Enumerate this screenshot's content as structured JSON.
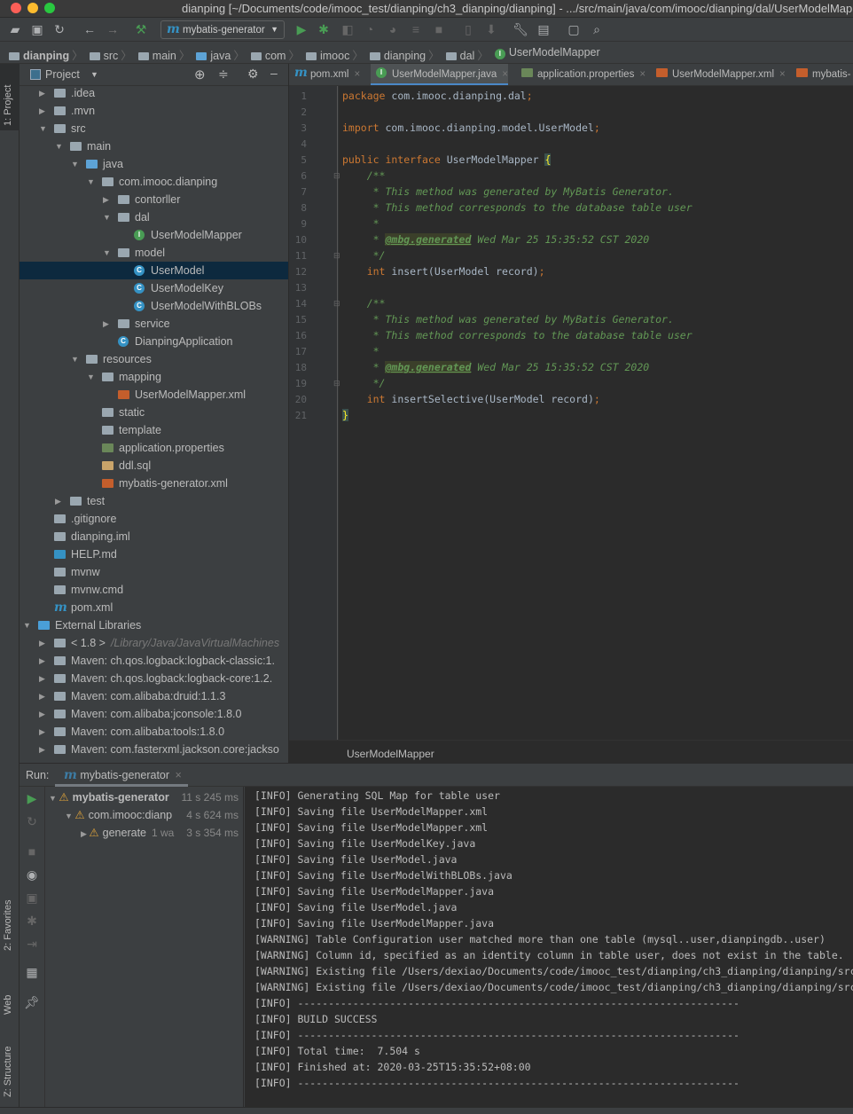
{
  "window": {
    "title": "dianping [~/Documents/code/imooc_test/dianping/ch3_dianping/dianping] - .../src/main/java/com/imooc/dianping/dal/UserModelMapper.java"
  },
  "toolbar": {
    "run_config": "mybatis-generator"
  },
  "breadcrumbs": [
    "dianping",
    "src",
    "main",
    "java",
    "com",
    "imooc",
    "dianping",
    "dal",
    "UserModelMapper"
  ],
  "left_strip": {
    "project": "1: Project",
    "favorites": "2: Favorites",
    "web": "Web",
    "structure": "Z: Structure"
  },
  "project": {
    "title": "Project",
    "tree": [
      {
        "label": ".idea",
        "depth": 1,
        "arrow": "closed",
        "icon": "folder"
      },
      {
        "label": ".mvn",
        "depth": 1,
        "arrow": "closed",
        "icon": "folder"
      },
      {
        "label": "src",
        "depth": 1,
        "arrow": "open",
        "icon": "folder"
      },
      {
        "label": "main",
        "depth": 2,
        "arrow": "open",
        "icon": "folder"
      },
      {
        "label": "java",
        "depth": 3,
        "arrow": "open",
        "icon": "folder-blue"
      },
      {
        "label": "com.imooc.dianping",
        "depth": 4,
        "arrow": "open",
        "icon": "package"
      },
      {
        "label": "contorller",
        "depth": 5,
        "arrow": "closed",
        "icon": "package"
      },
      {
        "label": "dal",
        "depth": 5,
        "arrow": "open",
        "icon": "package"
      },
      {
        "label": "UserModelMapper",
        "depth": 6,
        "arrow": "none",
        "icon": "interface"
      },
      {
        "label": "model",
        "depth": 5,
        "arrow": "open",
        "icon": "package"
      },
      {
        "label": "UserModel",
        "depth": 6,
        "arrow": "none",
        "icon": "class",
        "selected": true
      },
      {
        "label": "UserModelKey",
        "depth": 6,
        "arrow": "none",
        "icon": "class"
      },
      {
        "label": "UserModelWithBLOBs",
        "depth": 6,
        "arrow": "none",
        "icon": "class"
      },
      {
        "label": "service",
        "depth": 5,
        "arrow": "closed",
        "icon": "package"
      },
      {
        "label": "DianpingApplication",
        "depth": 5,
        "arrow": "none",
        "icon": "spring-class"
      },
      {
        "label": "resources",
        "depth": 3,
        "arrow": "open",
        "icon": "folder-res"
      },
      {
        "label": "mapping",
        "depth": 4,
        "arrow": "open",
        "icon": "folder"
      },
      {
        "label": "UserModelMapper.xml",
        "depth": 5,
        "arrow": "none",
        "icon": "xml"
      },
      {
        "label": "static",
        "depth": 4,
        "arrow": "none",
        "icon": "folder"
      },
      {
        "label": "template",
        "depth": 4,
        "arrow": "none",
        "icon": "folder"
      },
      {
        "label": "application.properties",
        "depth": 4,
        "arrow": "none",
        "icon": "properties"
      },
      {
        "label": "ddl.sql",
        "depth": 4,
        "arrow": "none",
        "icon": "sql"
      },
      {
        "label": "mybatis-generator.xml",
        "depth": 4,
        "arrow": "none",
        "icon": "xml"
      },
      {
        "label": "test",
        "depth": 2,
        "arrow": "closed",
        "icon": "folder"
      },
      {
        "label": ".gitignore",
        "depth": 1,
        "arrow": "none",
        "icon": "file"
      },
      {
        "label": "dianping.iml",
        "depth": 1,
        "arrow": "none",
        "icon": "file"
      },
      {
        "label": "HELP.md",
        "depth": 1,
        "arrow": "none",
        "icon": "md"
      },
      {
        "label": "mvnw",
        "depth": 1,
        "arrow": "none",
        "icon": "file"
      },
      {
        "label": "mvnw.cmd",
        "depth": 1,
        "arrow": "none",
        "icon": "file"
      },
      {
        "label": "pom.xml",
        "depth": 1,
        "arrow": "none",
        "icon": "maven"
      },
      {
        "label": "External Libraries",
        "depth": 0,
        "arrow": "open",
        "icon": "libraries"
      },
      {
        "label": "< 1.8 >",
        "suffix": "/Library/Java/JavaVirtualMachines",
        "depth": 1,
        "arrow": "closed",
        "icon": "jdk"
      },
      {
        "label": "Maven: ch.qos.logback:logback-classic:1.",
        "depth": 1,
        "arrow": "closed",
        "icon": "library"
      },
      {
        "label": "Maven: ch.qos.logback:logback-core:1.2.",
        "depth": 1,
        "arrow": "closed",
        "icon": "library"
      },
      {
        "label": "Maven: com.alibaba:druid:1.1.3",
        "depth": 1,
        "arrow": "closed",
        "icon": "library"
      },
      {
        "label": "Maven: com.alibaba:jconsole:1.8.0",
        "depth": 1,
        "arrow": "closed",
        "icon": "library"
      },
      {
        "label": "Maven: com.alibaba:tools:1.8.0",
        "depth": 1,
        "arrow": "closed",
        "icon": "library"
      },
      {
        "label": "Maven: com.fasterxml.jackson.core:jackso",
        "depth": 1,
        "arrow": "closed",
        "icon": "library"
      }
    ]
  },
  "editor": {
    "tabs": [
      {
        "label": "pom.xml",
        "icon": "maven"
      },
      {
        "label": "UserModelMapper.java",
        "icon": "interface",
        "active": true
      },
      {
        "label": "application.properties",
        "icon": "properties"
      },
      {
        "label": "UserModelMapper.xml",
        "icon": "xml"
      },
      {
        "label": "mybatis-",
        "icon": "xml"
      }
    ],
    "lines": [
      [
        [
          "kw",
          "package "
        ],
        [
          "",
          "com.imooc.dianping.dal"
        ],
        [
          "kw",
          ";"
        ]
      ],
      [],
      [
        [
          "kw",
          "import "
        ],
        [
          "",
          "com.imooc.dianping.model.UserModel"
        ],
        [
          "kw",
          ";"
        ]
      ],
      [],
      [
        [
          "kw",
          "public interface "
        ],
        [
          "",
          "UserModelMapper "
        ],
        [
          "brace",
          "{"
        ]
      ],
      [
        [
          "cm",
          "    /**"
        ]
      ],
      [
        [
          "cm",
          "     * This method was generated by MyBatis Generator."
        ]
      ],
      [
        [
          "cm",
          "     * This method corresponds to the database table user"
        ]
      ],
      [
        [
          "cm",
          "     *"
        ]
      ],
      [
        [
          "cm",
          "     * "
        ],
        [
          "tag",
          "@mbg.generated"
        ],
        [
          "cm",
          " Wed Mar 25 15:35:52 CST 2020"
        ]
      ],
      [
        [
          "cm",
          "     */"
        ]
      ],
      [
        [
          "kw",
          "    int "
        ],
        [
          "",
          "insert(UserModel record)"
        ],
        [
          "kw",
          ";"
        ]
      ],
      [],
      [
        [
          "cm",
          "    /**"
        ]
      ],
      [
        [
          "cm",
          "     * This method was generated by MyBatis Generator."
        ]
      ],
      [
        [
          "cm",
          "     * This method corresponds to the database table user"
        ]
      ],
      [
        [
          "cm",
          "     *"
        ]
      ],
      [
        [
          "cm",
          "     * "
        ],
        [
          "tag",
          "@mbg.generated"
        ],
        [
          "cm",
          " Wed Mar 25 15:35:52 CST 2020"
        ]
      ],
      [
        [
          "cm",
          "     */"
        ]
      ],
      [
        [
          "kw",
          "    int "
        ],
        [
          "",
          "insertSelective(UserModel record)"
        ],
        [
          "kw",
          ";"
        ]
      ],
      [
        [
          "brace",
          "}"
        ]
      ]
    ],
    "breadcrumb": "UserModelMapper"
  },
  "run": {
    "label": "Run:",
    "tab": "mybatis-generator",
    "tree": [
      {
        "label": "mybatis-generator",
        "duration": "11 s 245 ms",
        "bold": true,
        "arrow": "open",
        "depth": 0
      },
      {
        "label": "com.imooc:dianp",
        "duration": "4 s 624 ms",
        "arrow": "open",
        "depth": 1
      },
      {
        "label": "generate",
        "extra": "1 wa",
        "duration": "3 s 354 ms",
        "arrow": "closed",
        "depth": 2
      }
    ],
    "console": [
      "[INFO] Generating SQL Map for table user",
      "[INFO] Saving file UserModelMapper.xml",
      "[INFO] Saving file UserModelMapper.xml",
      "[INFO] Saving file UserModelKey.java",
      "[INFO] Saving file UserModel.java",
      "[INFO] Saving file UserModelWithBLOBs.java",
      "[INFO] Saving file UserModelMapper.java",
      "[INFO] Saving file UserModel.java",
      "[INFO] Saving file UserModelMapper.java",
      "[WARNING] Table Configuration user matched more than one table (mysql..user,dianpingdb..user)",
      "[WARNING] Column id, specified as an identity column in table user, does not exist in the table.",
      "[WARNING] Existing file /Users/dexiao/Documents/code/imooc_test/dianping/ch3_dianping/dianping/src",
      "[WARNING] Existing file /Users/dexiao/Documents/code/imooc_test/dianping/ch3_dianping/dianping/src",
      "[INFO] ------------------------------------------------------------------------",
      "[INFO] BUILD SUCCESS",
      "[INFO] ------------------------------------------------------------------------",
      "[INFO] Total time:  7.504 s",
      "[INFO] Finished at: 2020-03-25T15:35:52+08:00",
      "[INFO] ------------------------------------------------------------------------"
    ]
  },
  "colors": {
    "keyword": "#cc7832",
    "comment": "#629755",
    "text": "#a9b7c6",
    "selection": "#0d293e",
    "accent": "#4a88c7"
  }
}
